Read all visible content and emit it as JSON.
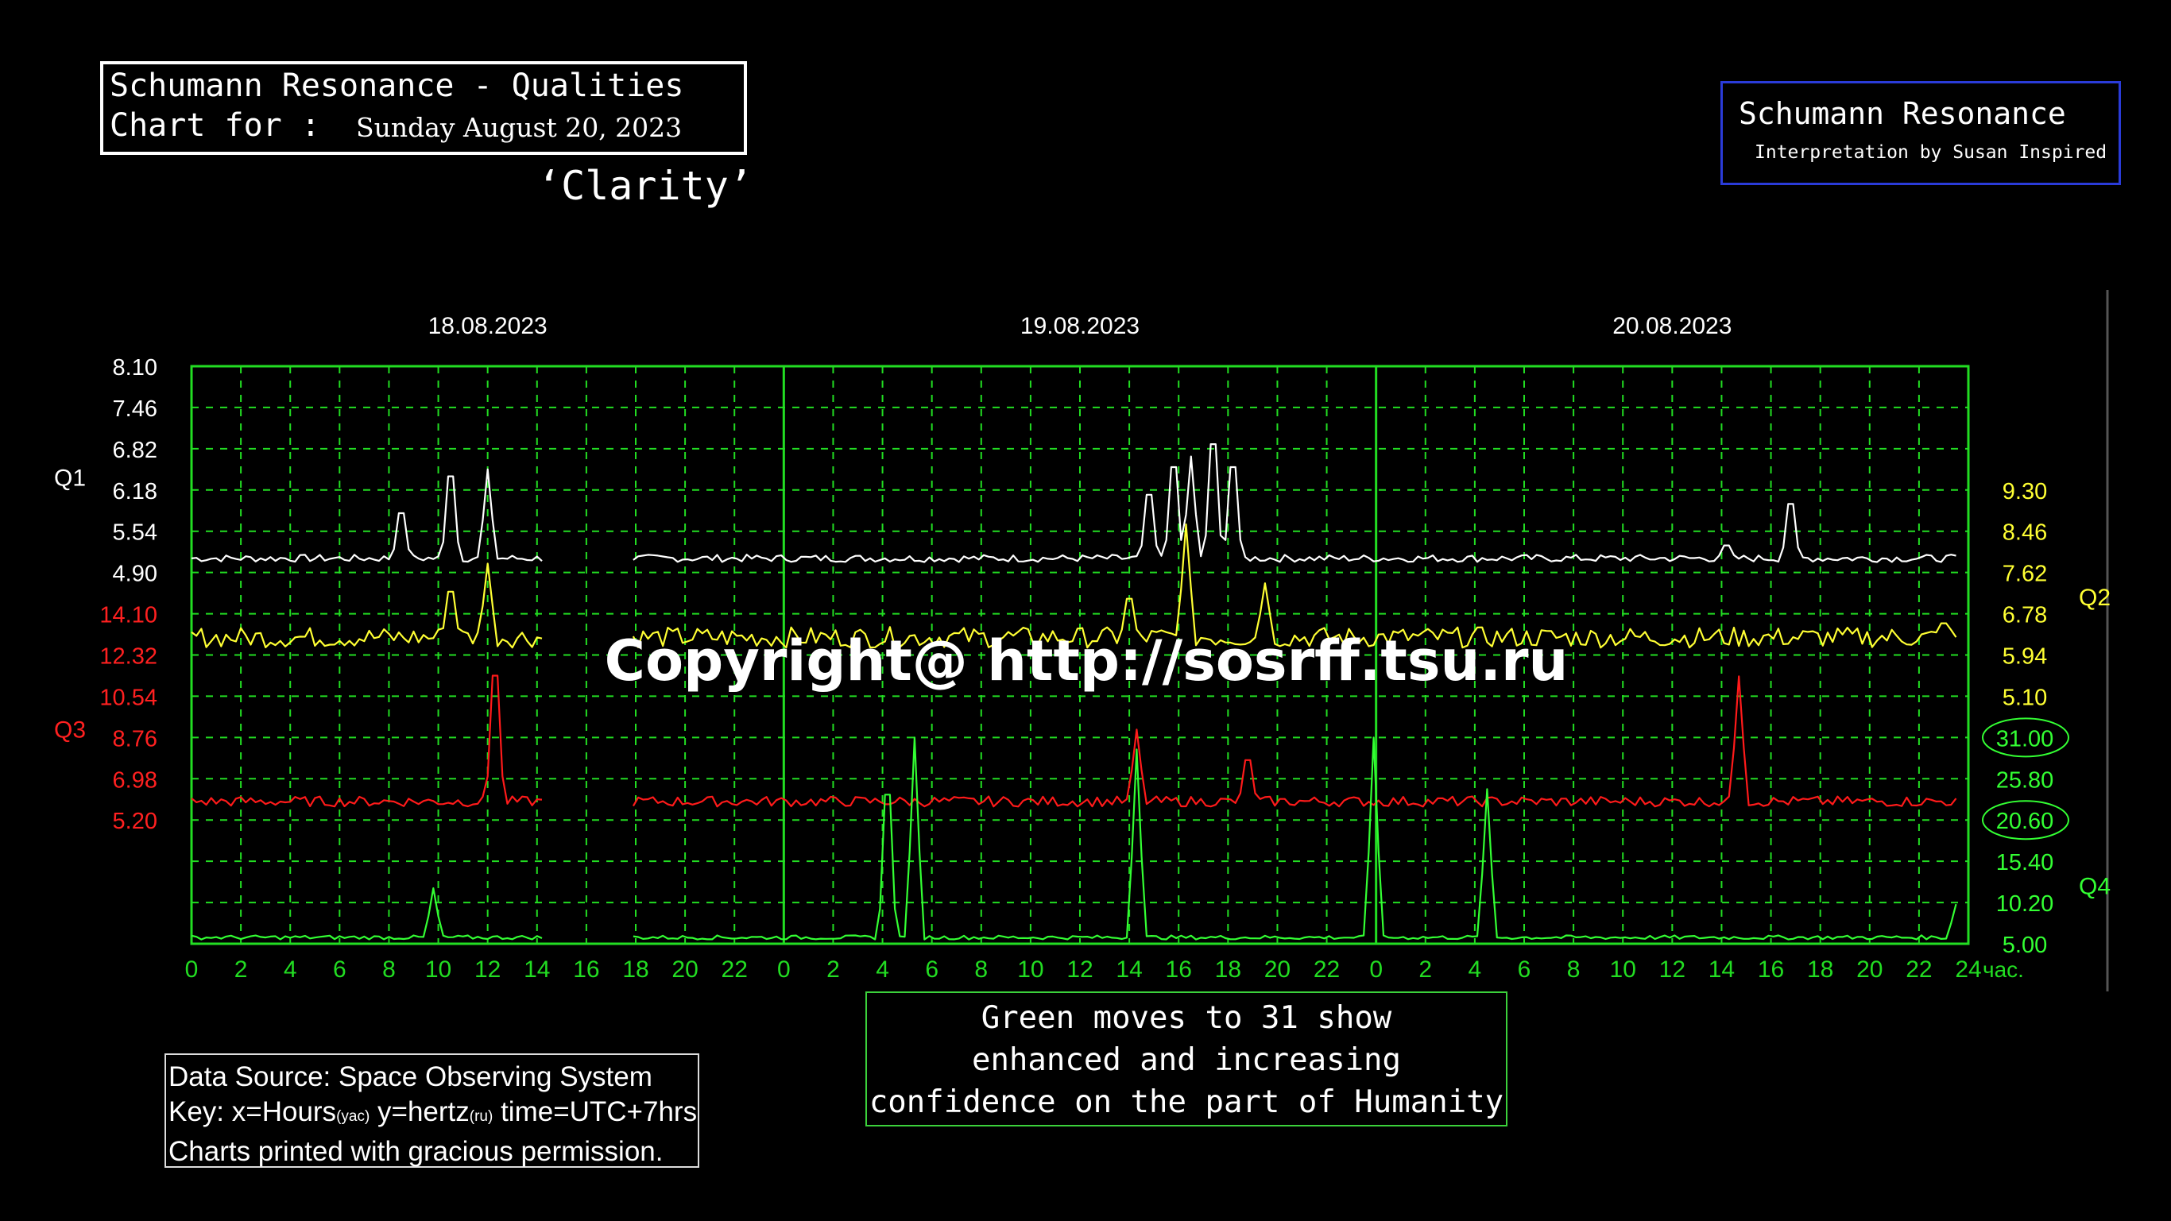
{
  "header": {
    "title_line1": "Schumann Resonance - Qualities",
    "title_line2": "Chart for :",
    "date": "Sunday August 20, 2023",
    "quality_word": "‘Clarity’"
  },
  "brand": {
    "title": "Schumann Resonance",
    "subtitle": "Interpretation by Susan Inspired",
    "border_color": "#2a3bd8"
  },
  "note": {
    "lines": [
      "Green moves to 31 show",
      "enhanced and increasing",
      "confidence on the part of Humanity"
    ],
    "border_color": "#3bd13b"
  },
  "source": {
    "line1": "Data Source: Space Observing System",
    "line2_a": "Key: x=Hours",
    "line2_a_sub": "(yac)",
    "line2_b": " y=hertz",
    "line2_b_sub": "(ru)",
    "line2_c": "  time=UTC+7hrs",
    "line3": "Charts printed with gracious permission."
  },
  "chart_data": {
    "type": "line",
    "watermark": "Copyright@ http://sosrff.tsu.ru",
    "day_labels": [
      "18.08.2023",
      "19.08.2023",
      "20.08.2023"
    ],
    "x_tick_labels": [
      "0",
      "2",
      "4",
      "6",
      "8",
      "10",
      "12",
      "14",
      "16",
      "18",
      "20",
      "22",
      "0",
      "2",
      "4",
      "6",
      "8",
      "10",
      "12",
      "14",
      "16",
      "18",
      "20",
      "22",
      "0",
      "2",
      "4",
      "6",
      "8",
      "10",
      "12",
      "14",
      "16",
      "18",
      "20",
      "22",
      "24"
    ],
    "x_unit": "час.",
    "x_range_hours": [
      0,
      72
    ],
    "data_gap_hours": [
      14.3,
      17.9
    ],
    "grid": true,
    "colors": {
      "Q1": "#ffffff",
      "Q2": "#ffff33",
      "Q3": "#ff1a1a",
      "Q4": "#33ff33",
      "axis": "#22dd22"
    },
    "axes": {
      "Q1": {
        "label": "Q1",
        "ticks": [
          "8.10",
          "7.46",
          "6.82",
          "6.18",
          "5.54",
          "4.90"
        ]
      },
      "Q3": {
        "label": "Q3",
        "ticks": [
          "14.10",
          "12.32",
          "10.54",
          "8.76",
          "6.98",
          "5.20"
        ]
      },
      "Q2": {
        "label": "Q2",
        "ticks": [
          "9.30",
          "8.46",
          "7.62",
          "6.78",
          "5.94",
          "5.10"
        ]
      },
      "Q4": {
        "label": "Q4",
        "ticks": [
          "31.00",
          "25.80",
          "20.60",
          "15.40",
          "10.20",
          "5.00"
        ],
        "circled": [
          "31.00",
          "20.60"
        ]
      }
    },
    "series": [
      {
        "name": "Q1",
        "axis": "Q1",
        "baseline": 5.12,
        "spikes": [
          [
            8.5,
            6.1
          ],
          [
            10.5,
            6.9
          ],
          [
            12,
            6.5
          ],
          [
            38.8,
            6.5
          ],
          [
            39.8,
            7.1
          ],
          [
            40.5,
            6.7
          ],
          [
            41.4,
            7.6
          ],
          [
            42.2,
            7.1
          ],
          [
            62.2,
            5.4
          ],
          [
            64.8,
            6.3
          ]
        ]
      },
      {
        "name": "Q2",
        "axis": "Q2",
        "baseline": 6.3,
        "spikes": [
          [
            10.5,
            7.6
          ],
          [
            12,
            7.8
          ],
          [
            38,
            7.4
          ],
          [
            40.3,
            8.6
          ],
          [
            43.5,
            7.4
          ],
          [
            71,
            6.7
          ]
        ]
      },
      {
        "name": "Q3",
        "axis": "Q3",
        "baseline": 6.0,
        "spikes": [
          [
            12.3,
            13.6
          ],
          [
            38.3,
            9.1
          ],
          [
            42.8,
            8.5
          ],
          [
            62.7,
            11.4
          ]
        ]
      },
      {
        "name": "Q4",
        "axis": "Q4",
        "baseline": 5.8,
        "spikes": [
          [
            9.8,
            12.0
          ],
          [
            28.2,
            31.0
          ],
          [
            29.3,
            31.0
          ],
          [
            38.3,
            29.5
          ],
          [
            47.9,
            31.0
          ],
          [
            52.5,
            24.5
          ],
          [
            71.5,
            10.0
          ]
        ]
      }
    ]
  }
}
